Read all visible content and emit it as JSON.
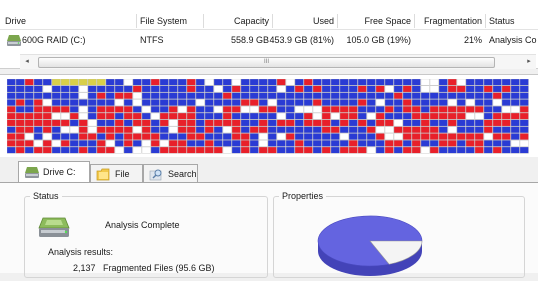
{
  "drive_list": {
    "columns": [
      "Drive",
      "File System",
      "Capacity",
      "Used",
      "Free Space",
      "Fragmentation",
      "Status"
    ],
    "rows": [
      {
        "drive": "600G RAID (C:)",
        "icon": "hard-drive-icon",
        "file_system": "NTFS",
        "capacity": "558.9 GB",
        "used": "453.9 GB (81%)",
        "free_space": "105.0 GB (19%)",
        "fragmentation": "21%",
        "status": "Analysis Co"
      }
    ],
    "scrollbar": {
      "left_arrow": "◂",
      "right_arrow": "▸",
      "thumb_grip": "III"
    }
  },
  "cluster_map": {
    "colors": {
      "fragmented": "#e8202a",
      "contiguous": "#2a3bd4",
      "free": "#ffffff",
      "system": "#d8cf4a",
      "grid": "#b9b9b9"
    }
  },
  "tabs": [
    {
      "label": "Drive C:",
      "icon": "drive-icon",
      "active": true
    },
    {
      "label": "File list",
      "icon": "folder-icon",
      "active": false
    },
    {
      "label": "Search",
      "icon": "search-icon",
      "active": false
    }
  ],
  "status_panel": {
    "title": "Status",
    "message": "Analysis Complete",
    "results_label": "Analysis results:",
    "fragmented_count": "2,137",
    "fragmented_text": "Fragmented Files (95.6 GB)"
  },
  "properties_panel": {
    "title": "Properties",
    "used_percent": 81,
    "colors": {
      "used": "#6464e0",
      "free": "#f4f4f4"
    }
  }
}
